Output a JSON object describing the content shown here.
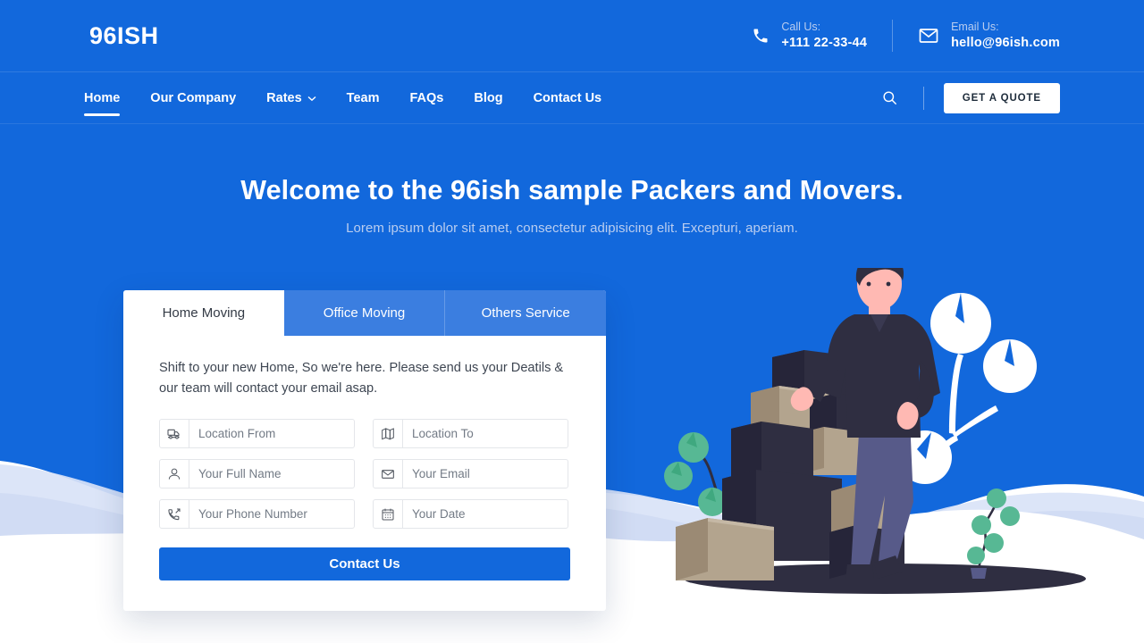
{
  "brand": {
    "logo": "96ISH"
  },
  "colors": {
    "primary_blue": "#1268dc",
    "tab_inactive_blue": "#3b7ee0",
    "muted_text": "#b9cdf0",
    "card_white": "#ffffff",
    "box_dark": "#2f2e41",
    "box_tan": "#a69177",
    "plant_green": "#57b894",
    "skin": "#ffb9b3"
  },
  "topbar": {
    "call": {
      "icon": "phone-icon",
      "label": "Call Us:",
      "value": "+111 22-33-44"
    },
    "email": {
      "icon": "envelope-icon",
      "label": "Email Us:",
      "value": "hello@96ish.com"
    }
  },
  "nav": {
    "items": [
      {
        "label": "Home",
        "active": true,
        "has_chevron": false
      },
      {
        "label": "Our Company",
        "active": false,
        "has_chevron": false
      },
      {
        "label": "Rates",
        "active": false,
        "has_chevron": true
      },
      {
        "label": "Team",
        "active": false,
        "has_chevron": false
      },
      {
        "label": "FAQs",
        "active": false,
        "has_chevron": false
      },
      {
        "label": "Blog",
        "active": false,
        "has_chevron": false
      },
      {
        "label": "Contact Us",
        "active": false,
        "has_chevron": false
      }
    ],
    "search_icon": "search-icon",
    "quote_button": "GET A QUOTE"
  },
  "hero": {
    "title": "Welcome to the 96ish sample Packers and Movers.",
    "subtitle": "Lorem ipsum dolor sit amet, consectetur adipisicing elit. Excepturi, aperiam."
  },
  "booking_card": {
    "tabs": [
      {
        "label": "Home Moving",
        "active": true
      },
      {
        "label": "Office Moving",
        "active": false
      },
      {
        "label": "Others Service",
        "active": false
      }
    ],
    "description": "Shift to your new Home, So we're here. Please send us your Deatils & our team will contact your email asap.",
    "fields": [
      {
        "icon": "truck-icon",
        "placeholder": "Location From",
        "value": ""
      },
      {
        "icon": "map-icon",
        "placeholder": "Location To",
        "value": ""
      },
      {
        "icon": "user-icon",
        "placeholder": "Your Full Name",
        "value": ""
      },
      {
        "icon": "envelope-icon",
        "placeholder": "Your Email",
        "value": ""
      },
      {
        "icon": "phone-out-icon",
        "placeholder": "Your Phone Number",
        "value": ""
      },
      {
        "icon": "calendar-icon",
        "placeholder": "Your Date",
        "value": ""
      }
    ],
    "submit_label": "Contact Us"
  },
  "illustration": {
    "name": "mover-with-boxes-illustration",
    "elements": [
      "man",
      "stacked-boxes",
      "plants",
      "white-tree",
      "ground-shadow"
    ]
  }
}
